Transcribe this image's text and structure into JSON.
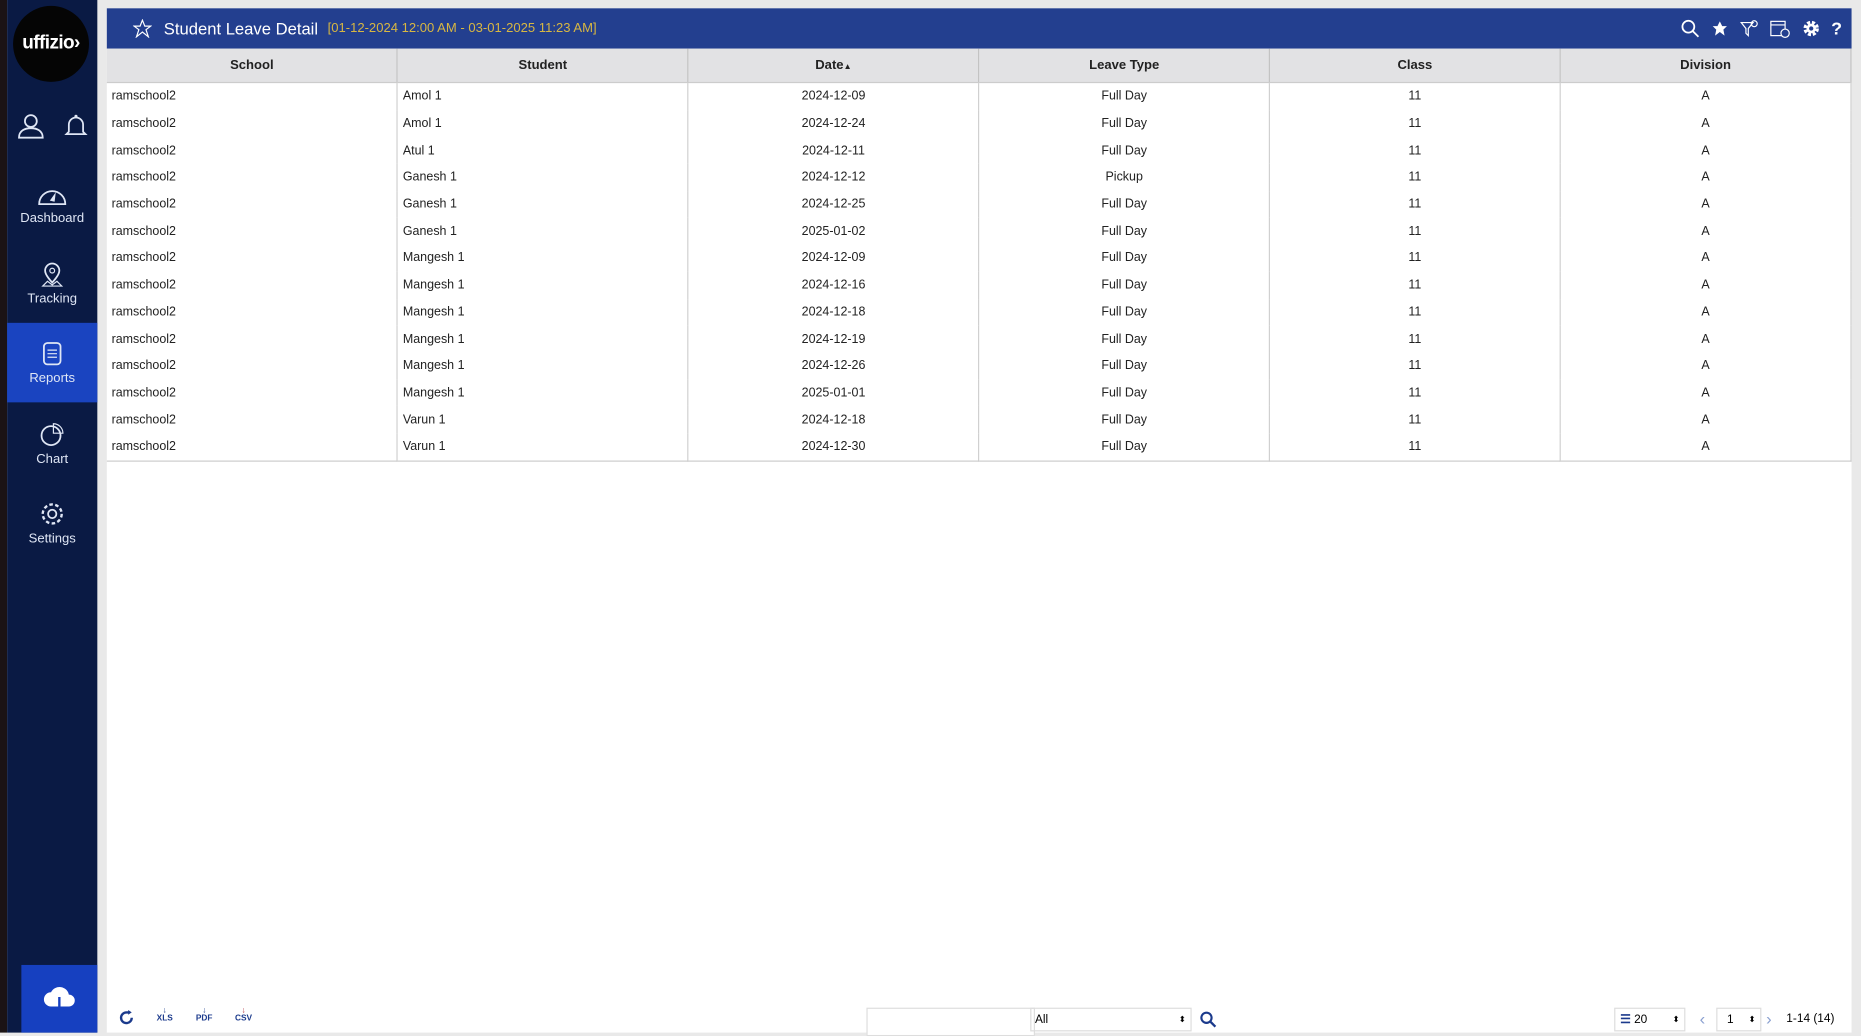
{
  "sidebar": {
    "logo": "uffizio",
    "items": [
      {
        "label": "Dashboard"
      },
      {
        "label": "Tracking"
      },
      {
        "label": "Reports",
        "active": true
      },
      {
        "label": "Chart"
      },
      {
        "label": "Settings"
      }
    ]
  },
  "header": {
    "title": "Student Leave Detail",
    "range": "[01-12-2024 12:00 AM - 03-01-2025 11:23 AM]"
  },
  "table": {
    "columns": [
      "School",
      "Student",
      "Date",
      "Leave Type",
      "Class",
      "Division"
    ],
    "sort_indicator": "▲",
    "rows": [
      [
        "ramschool2",
        "Amol 1",
        "2024-12-09",
        "Full Day",
        "11",
        "A"
      ],
      [
        "ramschool2",
        "Amol 1",
        "2024-12-24",
        "Full Day",
        "11",
        "A"
      ],
      [
        "ramschool2",
        "Atul 1",
        "2024-12-11",
        "Full Day",
        "11",
        "A"
      ],
      [
        "ramschool2",
        "Ganesh 1",
        "2024-12-12",
        "Pickup",
        "11",
        "A"
      ],
      [
        "ramschool2",
        "Ganesh 1",
        "2024-12-25",
        "Full Day",
        "11",
        "A"
      ],
      [
        "ramschool2",
        "Ganesh 1",
        "2025-01-02",
        "Full Day",
        "11",
        "A"
      ],
      [
        "ramschool2",
        "Mangesh 1",
        "2024-12-09",
        "Full Day",
        "11",
        "A"
      ],
      [
        "ramschool2",
        "Mangesh 1",
        "2024-12-16",
        "Full Day",
        "11",
        "A"
      ],
      [
        "ramschool2",
        "Mangesh 1",
        "2024-12-18",
        "Full Day",
        "11",
        "A"
      ],
      [
        "ramschool2",
        "Mangesh 1",
        "2024-12-19",
        "Full Day",
        "11",
        "A"
      ],
      [
        "ramschool2",
        "Mangesh 1",
        "2024-12-26",
        "Full Day",
        "11",
        "A"
      ],
      [
        "ramschool2",
        "Mangesh 1",
        "2025-01-01",
        "Full Day",
        "11",
        "A"
      ],
      [
        "ramschool2",
        "Varun 1",
        "2024-12-18",
        "Full Day",
        "11",
        "A"
      ],
      [
        "ramschool2",
        "Varun 1",
        "2024-12-30",
        "Full Day",
        "11",
        "A"
      ]
    ]
  },
  "footer": {
    "xls": "XLS",
    "pdf": "PDF",
    "csv": "CSV",
    "search_value": "",
    "filter": "All",
    "page_size": "20",
    "page": "1",
    "summary": "1-14 (14)"
  }
}
